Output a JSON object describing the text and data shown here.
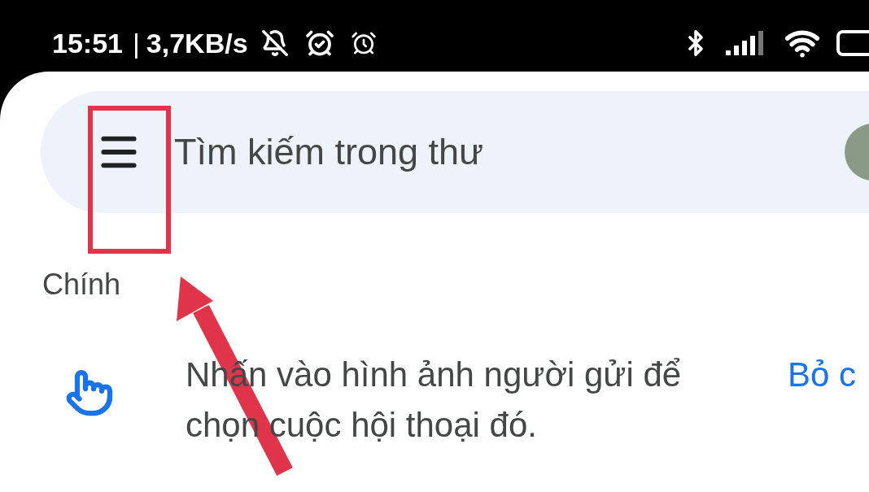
{
  "status_bar": {
    "time": "15:51",
    "separator": "|",
    "speed": "3,7KB/s"
  },
  "search": {
    "placeholder": "Tìm kiếm trong thư"
  },
  "section_label": "Chính",
  "tip": {
    "text": "Nhấn vào hình ảnh người gửi để chọn cuộc hội thoại đó.",
    "action": "Bỏ c"
  }
}
